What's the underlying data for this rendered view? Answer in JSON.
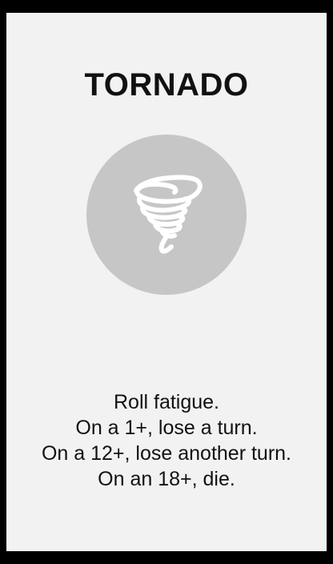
{
  "card": {
    "title": "TORNADO",
    "icon": "tornado-icon",
    "lines": [
      "Roll fatigue.",
      "On a 1+, lose a turn.",
      "On a 12+, lose another turn.",
      "On an 18+, die."
    ]
  },
  "colors": {
    "background": "#000000",
    "card": "#f2f2f2",
    "icon_circle": "#c6c6c6",
    "icon": "#ffffff",
    "text": "#111111"
  }
}
